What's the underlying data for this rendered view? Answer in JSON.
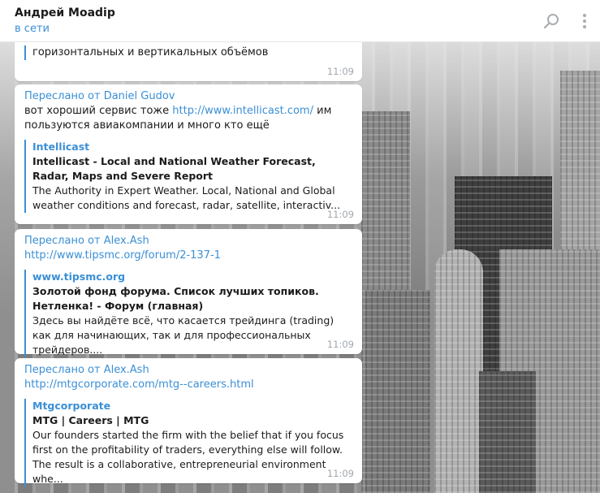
{
  "header": {
    "title": "Андрей Moadip",
    "status": "в сети",
    "search_icon": "search-icon",
    "more_icon": "vertical-dots-icon"
  },
  "messages": [
    {
      "partial_text": "горизонтальных и вертикальных объёмов",
      "time": "11:09"
    },
    {
      "forwarded": "Переслано от Daniel Gudov",
      "text_before": "вот хороший сервис тоже ",
      "link": "http://www.intellicast.com/",
      "text_after": " им пользуются авиакомпании и много кто ещё",
      "preview": {
        "site": "Intellicast",
        "title": "Intellicast - Local and National Weather Forecast, Radar, Maps and Severe Report",
        "description": "The Authority in Expert Weather. Local, National and Global weather conditions and forecast, radar, satellite, interactiv..."
      },
      "time": "11:09"
    },
    {
      "forwarded": "Переслано от Alex.Ash",
      "link": "http://www.tipsmc.org/forum/2-137-1",
      "preview": {
        "site": "www.tipsmc.org",
        "title": "Золотой фонд форума. Список лучших топиков. Нетленка! - Форум (главная)",
        "description": "Здесь вы найдёте всё, что касается трейдинга (trading) как для начинающих, так и для профессиональных трейдеров...."
      },
      "time": "11:09"
    },
    {
      "forwarded": "Переслано от Alex.Ash",
      "link": "http://mtgcorporate.com/mtg--careers.html",
      "preview": {
        "site": "Mtgcorporate",
        "title": "MTG | Careers | MTG",
        "description": "Our founders started the firm with the belief that if you focus first on the profitability of traders, everything else will follow.  The result is a collaborative, entrepreneurial environment whe..."
      },
      "time": "11:09"
    }
  ]
}
